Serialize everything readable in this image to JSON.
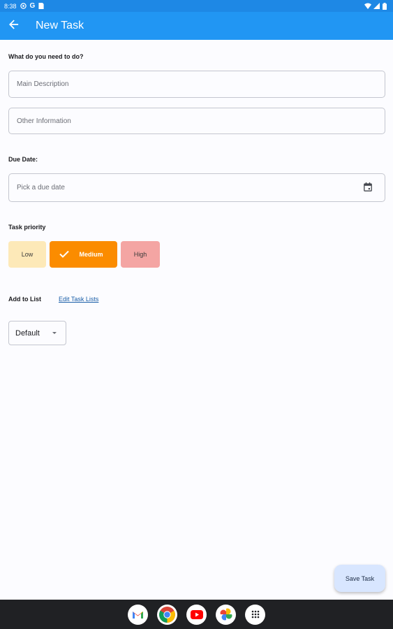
{
  "status_bar": {
    "time": "8:38"
  },
  "app_bar": {
    "title": "New Task"
  },
  "form": {
    "what_label": "What do you need to do?",
    "main_description_placeholder": "Main Description",
    "other_information_placeholder": "Other Information",
    "due_date_label": "Due Date:",
    "due_date_placeholder": "Pick a due date",
    "priority_label": "Task priority",
    "priorities": [
      {
        "label": "Low",
        "selected": false,
        "color": "#fde9b8"
      },
      {
        "label": "Medium",
        "selected": true,
        "color": "#fb8c00"
      },
      {
        "label": "High",
        "selected": false,
        "color": "#f4a5a3"
      }
    ],
    "add_to_list_label": "Add to List",
    "edit_lists_link": "Edit Task Lists",
    "list_selected": "Default"
  },
  "fab": {
    "label": "Save Task"
  },
  "colors": {
    "app_bar": "#2196f3",
    "status_bar": "#1e88e5",
    "fab_bg": "#d8e6ff"
  },
  "dock": {
    "apps": [
      "gmail-icon",
      "chrome-icon",
      "youtube-icon",
      "photos-icon",
      "app-drawer-icon"
    ]
  }
}
